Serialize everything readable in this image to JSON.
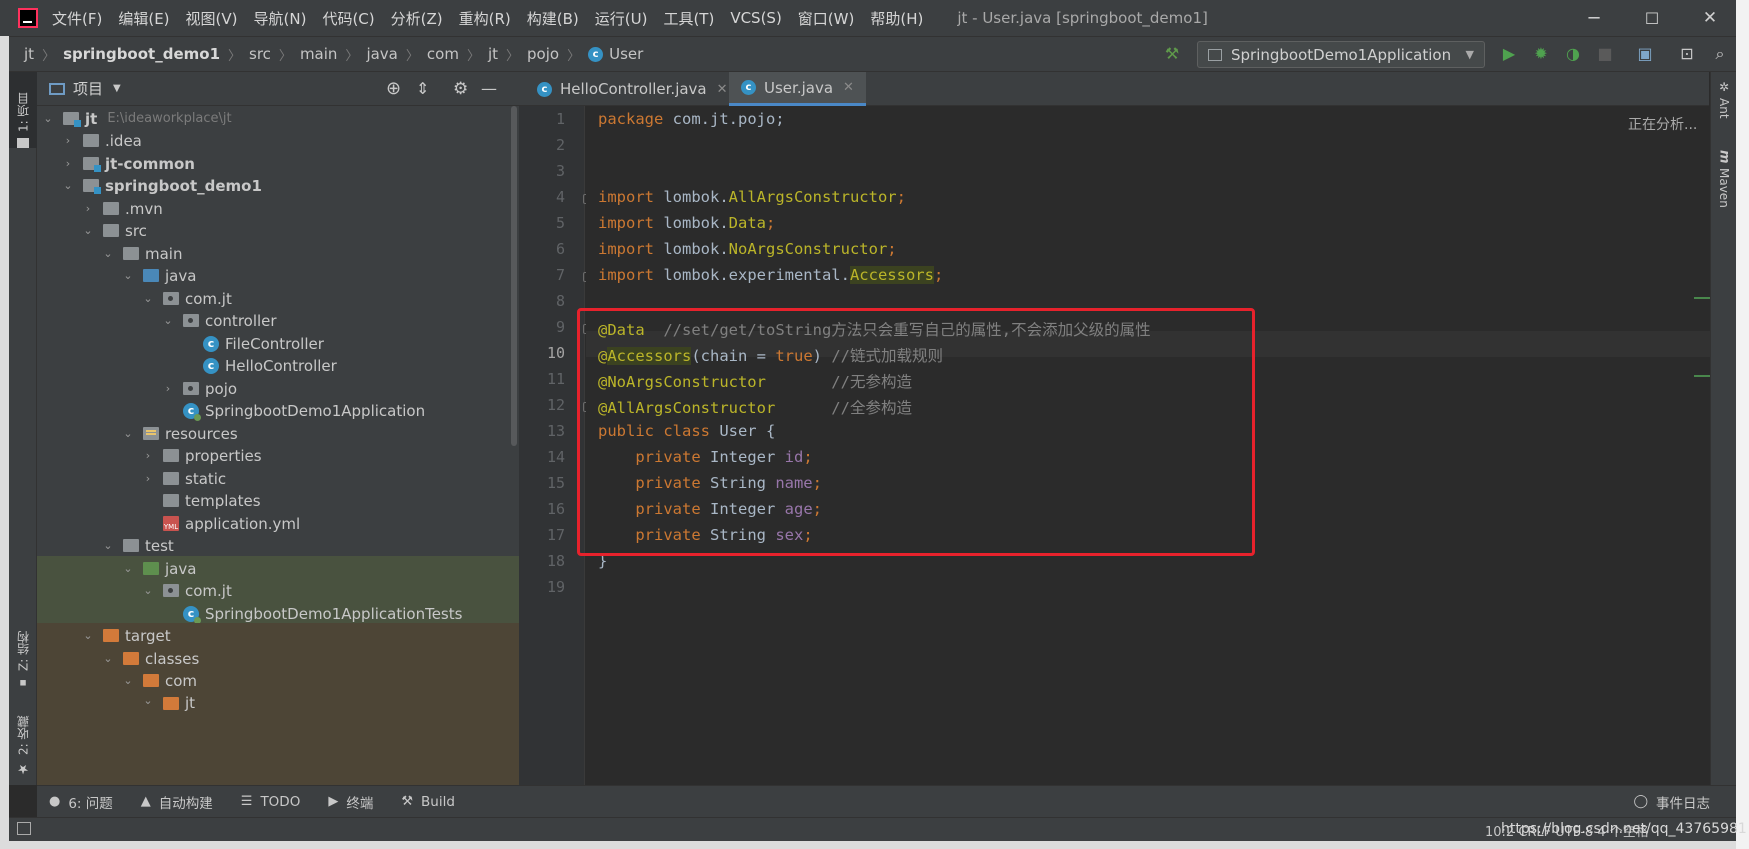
{
  "titlebar": {
    "menu": [
      "文件(F)",
      "编辑(E)",
      "视图(V)",
      "导航(N)",
      "代码(C)",
      "分析(Z)",
      "重构(R)",
      "构建(B)",
      "运行(U)",
      "工具(T)",
      "VCS(S)",
      "窗口(W)",
      "帮助(H)"
    ],
    "window_title": "jt - User.java [springboot_demo1]",
    "minimize": "─",
    "maximize": "☐",
    "close": "✕"
  },
  "navbar": {
    "crumbs": [
      "jt",
      "springboot_demo1",
      "src",
      "main",
      "java",
      "com",
      "jt",
      "pojo",
      "User"
    ],
    "run_config": "SpringbootDemo1Application"
  },
  "left_stripe": {
    "project": "1: 项目",
    "structure": "Z: 结构",
    "favorites": "2: 收藏"
  },
  "project_panel": {
    "title": "项目",
    "tree": [
      {
        "label": "jt",
        "hint": "E:\\ideaworkplace\\jt"
      },
      {
        "label": ".idea"
      },
      {
        "label": "jt-common"
      },
      {
        "label": "springboot_demo1"
      },
      {
        "label": ".mvn"
      },
      {
        "label": "src"
      },
      {
        "label": "main"
      },
      {
        "label": "java"
      },
      {
        "label": "com.jt"
      },
      {
        "label": "controller"
      },
      {
        "label": "FileController"
      },
      {
        "label": "HelloController"
      },
      {
        "label": "pojo"
      },
      {
        "label": "SpringbootDemo1Application"
      },
      {
        "label": "resources"
      },
      {
        "label": "properties"
      },
      {
        "label": "static"
      },
      {
        "label": "templates"
      },
      {
        "label": "application.yml"
      },
      {
        "label": "test"
      },
      {
        "label": "java"
      },
      {
        "label": "com.jt"
      },
      {
        "label": "SpringbootDemo1ApplicationTests"
      },
      {
        "label": "target"
      },
      {
        "label": "classes"
      },
      {
        "label": "com"
      },
      {
        "label": "jt"
      }
    ]
  },
  "editor": {
    "tabs": [
      {
        "label": "HelloController.java",
        "active": false
      },
      {
        "label": "User.java",
        "active": true
      }
    ],
    "status_text": "正在分析...",
    "line_numbers": [
      "1",
      "2",
      "3",
      "4",
      "5",
      "6",
      "7",
      "8",
      "9",
      "10",
      "11",
      "12",
      "13",
      "14",
      "15",
      "16",
      "17",
      "18",
      "19"
    ],
    "code": {
      "l1_kw": "package",
      "l1_rest": " com.jt.pojo;",
      "l4_kw": "import",
      "l4_a": " lombok.",
      "l4_b": "AllArgsConstructor",
      "l4_c": ";",
      "l5_kw": "import",
      "l5_a": " lombok.",
      "l5_b": "Data",
      "l5_c": ";",
      "l6_kw": "import",
      "l6_a": " lombok.",
      "l6_b": "NoArgsConstructor",
      "l6_c": ";",
      "l7_kw": "import",
      "l7_a": " lombok.experimental.",
      "l7_b": "Accessors",
      "l7_c": ";",
      "l9_ann": "@Data",
      "l9_cm": "  //set/get/toString方法只会重写自己的属性,不会添加父级的属性",
      "l10_at": "@",
      "l10_ann": "Accessors",
      "l10_a": "(chain = ",
      "l10_kw": "true",
      "l10_b": ") ",
      "l10_cm": "//链式加载规则",
      "l11_ann": "@NoArgsConstructor",
      "l11_cm": "       //无参构造",
      "l12_ann": "@AllArgsConstructor",
      "l12_cm": "      //全参构造",
      "l13_kw": "public class",
      "l13_rest": " User {",
      "l14_kw": "    private",
      "l14_ty": " Integer ",
      "l14_fd": "id",
      "l14_end": ";",
      "l15_kw": "    private",
      "l15_ty": " String ",
      "l15_fd": "name",
      "l15_end": ";",
      "l16_kw": "    private",
      "l16_ty": " Integer ",
      "l16_fd": "age",
      "l16_end": ";",
      "l17_kw": "    private",
      "l17_ty": " String ",
      "l17_fd": "sex",
      "l17_end": ";",
      "l18": "}"
    }
  },
  "right_stripe": {
    "ant": "Ant",
    "maven": "Maven"
  },
  "bottom_tools": [
    {
      "icon": "problems-icon",
      "label": "6: 问题"
    },
    {
      "icon": "warning-icon",
      "label": "自动构建"
    },
    {
      "icon": "todo-icon",
      "label": "TODO"
    },
    {
      "icon": "terminal-icon",
      "label": "终端"
    },
    {
      "icon": "build-icon",
      "label": "Build"
    }
  ],
  "event_log": "事件日志",
  "status_bar": {
    "right": "10:2  CRLF  UTF-8  4 个空格",
    "watermark": "https://blog.csdn.net/qq_43765981"
  },
  "colors": {
    "accent": "#4a88c7",
    "highlight_box": "#e7222c",
    "keyword": "#cc7832",
    "annotation": "#bbb529",
    "comment": "#808080",
    "field": "#9876aa"
  }
}
